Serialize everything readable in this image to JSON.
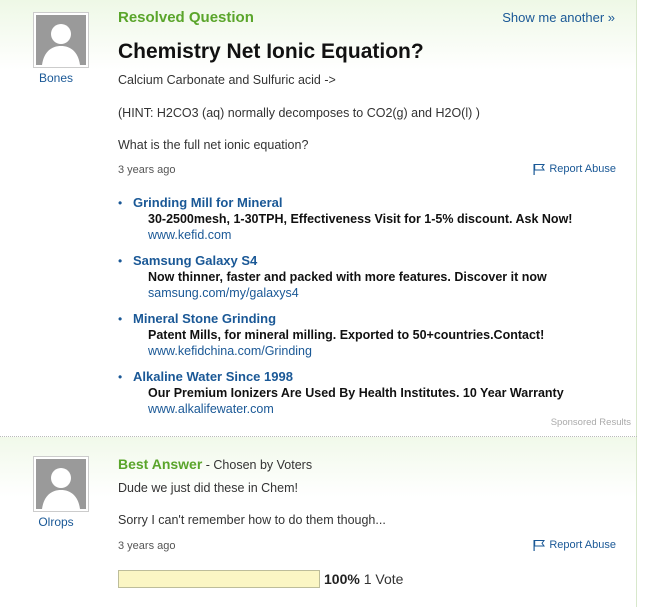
{
  "question": {
    "status_label": "Resolved Question",
    "show_another": "Show me another »",
    "title": "Chemistry Net Ionic Equation?",
    "body": [
      "Calcium Carbonate and Sulfuric acid ->",
      "(HINT: H2CO3 (aq) normally decomposes to CO2(g) and H2O(l) )",
      "What is the full net ionic equation?"
    ],
    "age": "3 years ago",
    "report_label": "Report Abuse",
    "asker": "Bones"
  },
  "ads": [
    {
      "title": "Grinding Mill for Mineral",
      "desc": "30-2500mesh, 1-30TPH, Effectiveness Visit for 1-5% discount. Ask Now!",
      "url": "www.kefid.com"
    },
    {
      "title": "Samsung Galaxy S4",
      "desc": "Now thinner, faster and packed with more features. Discover it now",
      "url": "samsung.com/my/galaxys4"
    },
    {
      "title": "Mineral Stone Grinding",
      "desc": "Patent Mills, for mineral milling. Exported to 50+countries.Contact!",
      "url": "www.kefidchina.com/Grinding"
    },
    {
      "title": "Alkaline Water Since 1998",
      "desc": "Our Premium Ionizers Are Used By Health Institutes. 10 Year Warranty",
      "url": "www.alkalifewater.com"
    }
  ],
  "sponsored_label": "Sponsored Results",
  "answer": {
    "label": "Best Answer",
    "chosen_by": " - Chosen by Voters",
    "body": [
      "Dude we just did these in Chem!",
      "Sorry I can't remember how to do them though..."
    ],
    "age": "3 years ago",
    "report_label": "Report Abuse",
    "answerer": "Olrops",
    "vote_percent_label": "100%",
    "vote_count_label": "1 Vote",
    "vote_fraction": 1.0
  },
  "colors": {
    "accent_green": "#5aa52b",
    "link_blue": "#1a5896",
    "vote_fill": "#fbf6c4"
  },
  "icons": {
    "avatar": "default-user-silhouette",
    "report": "flag-icon"
  }
}
